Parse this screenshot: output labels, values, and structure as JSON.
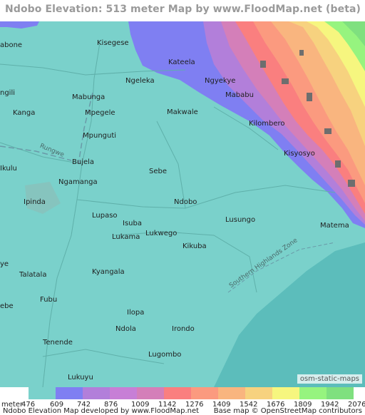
{
  "title": "Ndobo Elevation: 513 meter Map by www.FloodMap.net (beta)",
  "map": {
    "places": [
      {
        "name": "Kisegese"
      },
      {
        "name": "abone"
      },
      {
        "name": "Kateela"
      },
      {
        "name": "Ngyekye"
      },
      {
        "name": "Mababu"
      },
      {
        "name": "Ngeleka"
      },
      {
        "name": "ngili"
      },
      {
        "name": "Mabunga"
      },
      {
        "name": "Makwale"
      },
      {
        "name": "Mpegele"
      },
      {
        "name": "Kanga"
      },
      {
        "name": "Kilombero"
      },
      {
        "name": "Mpunguti"
      },
      {
        "name": "Kisyosyo"
      },
      {
        "name": "Ikulu"
      },
      {
        "name": "Bujela"
      },
      {
        "name": "Sebe"
      },
      {
        "name": "Ngamanga"
      },
      {
        "name": "Ndobo"
      },
      {
        "name": "Ipinda"
      },
      {
        "name": "Lupaso"
      },
      {
        "name": "Lusungo"
      },
      {
        "name": "Matema"
      },
      {
        "name": "Isuba"
      },
      {
        "name": "Lukwego"
      },
      {
        "name": "Lukama"
      },
      {
        "name": "Kikuba"
      },
      {
        "name": "Kyangala"
      },
      {
        "name": "ye"
      },
      {
        "name": "Talatala"
      },
      {
        "name": "Fubu"
      },
      {
        "name": "ebe"
      },
      {
        "name": "Ilopa"
      },
      {
        "name": "Ndola"
      },
      {
        "name": "Irondo"
      },
      {
        "name": "Tenende"
      },
      {
        "name": "Lugombo"
      },
      {
        "name": "Lukuyu"
      }
    ],
    "road_labels": [
      "Rungwe",
      "Southern Highlands Zone"
    ],
    "attribution_badge": "osm-static-maps"
  },
  "legend": {
    "unit": "meter",
    "ticks": [
      "476",
      "609",
      "742",
      "876",
      "1009",
      "1142",
      "1276",
      "1409",
      "1542",
      "1676",
      "1809",
      "1942",
      "2076"
    ],
    "colors": [
      "#7ad1cb",
      "#7f7ff2",
      "#b27fda",
      "#c77fd6",
      "#d47fb9",
      "#fa7f7f",
      "#fb9a7f",
      "#f9b57f",
      "#f7d27f",
      "#f6f67f",
      "#96f47f",
      "#7fe07f"
    ]
  },
  "footer": {
    "left": "Ndobo Elevation Map developed by www.FloodMap.net",
    "right": "Base map © OpenStreetMap contributors"
  }
}
